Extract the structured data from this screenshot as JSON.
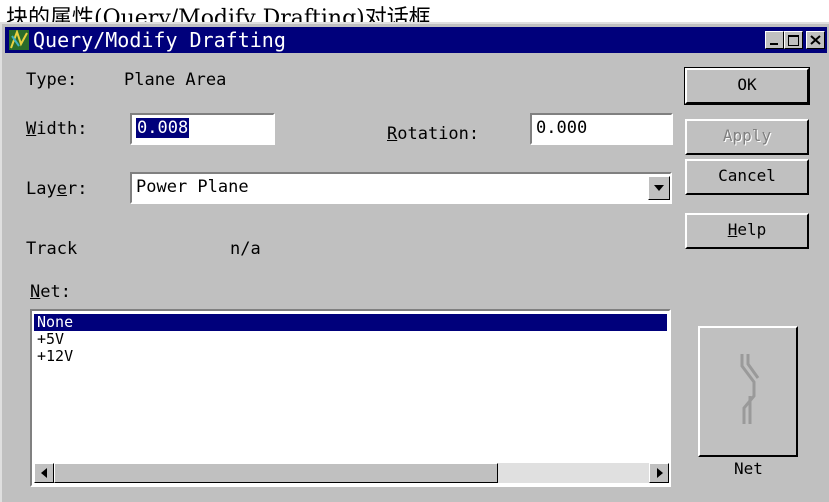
{
  "caption": "块的属性(Query/Modify Drafting)对话框",
  "window": {
    "title": "Query/Modify Drafting"
  },
  "type": {
    "label": "Type:",
    "value": "Plane Area"
  },
  "width": {
    "label_prefix": "",
    "label_mnemonic": "W",
    "label_rest": "idth:",
    "value": "0.008"
  },
  "rotation": {
    "label_mnemonic": "R",
    "label_rest": "otation:",
    "value": "0.000"
  },
  "layer": {
    "label_prefix": "Lay",
    "label_mnemonic": "e",
    "label_rest": "r:",
    "value": "Power Plane"
  },
  "track": {
    "label": "Track",
    "value": "n/a"
  },
  "net": {
    "label_mnemonic": "N",
    "label_rest": "et:",
    "items": [
      "None",
      "+5V",
      "+12V"
    ],
    "selected": "None"
  },
  "buttons": {
    "ok": "OK",
    "apply": "Apply",
    "cancel": "Cancel",
    "help_mnemonic": "H",
    "help_rest": "elp",
    "net": "Net"
  },
  "colors": {
    "titlebar": "#00007b",
    "face": "#c0c0c0",
    "selection": "#00007b"
  },
  "icons": [
    "app-icon",
    "minimize-icon",
    "maximize-icon",
    "close-icon",
    "dropdown-arrow-icon",
    "scroll-left-icon",
    "scroll-right-icon",
    "net-icon"
  ]
}
